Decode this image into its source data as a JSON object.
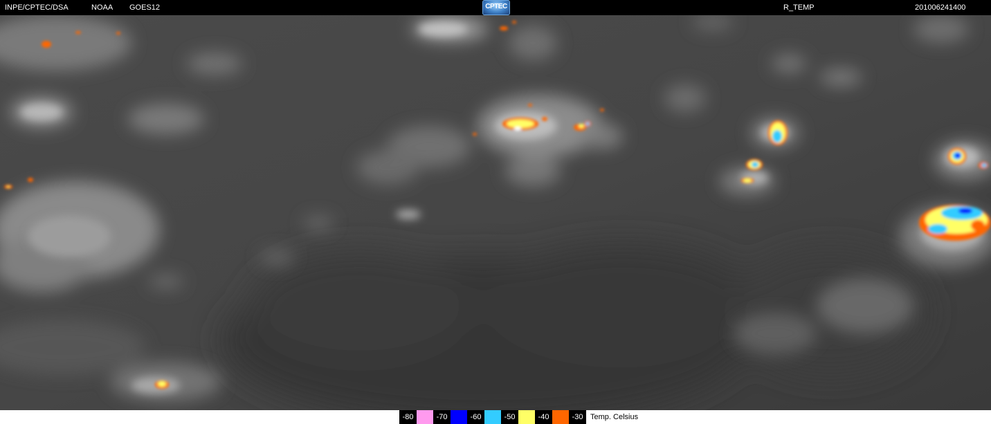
{
  "header": {
    "source": "INPE/CPTEC/DSA",
    "agency": "NOAA",
    "satellite": "GOES12",
    "logo_text": "CPTEC",
    "product": "R_TEMP",
    "timestamp": "201006241400"
  },
  "legend": {
    "entries": [
      {
        "label": "-80",
        "color": "#ff9aee"
      },
      {
        "label": "-70",
        "color": "#0000ff"
      },
      {
        "label": "-60",
        "color": "#33ccff"
      },
      {
        "label": "-50",
        "color": "#ffff66"
      },
      {
        "label": "-40",
        "color": "#ff6600"
      },
      {
        "label": "-30",
        "color": null
      }
    ],
    "unit": "Temp. Celsius"
  }
}
